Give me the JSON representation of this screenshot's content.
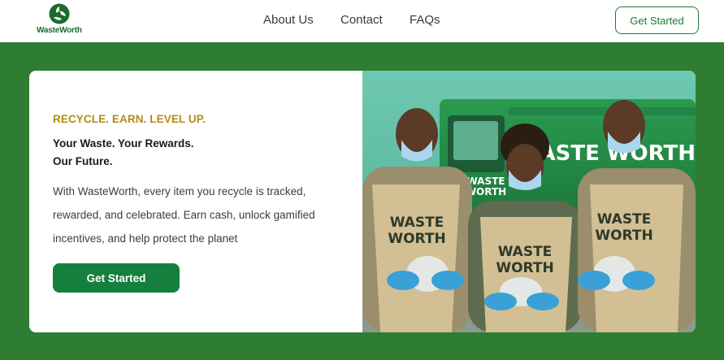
{
  "brand": {
    "name": "WasteWorth",
    "logo_icon": "recycle-leaf-icon",
    "primary_color": "#1e7a35",
    "background_color": "#2f7d32",
    "accent_color": "#b38b12"
  },
  "nav": {
    "links": [
      "About Us",
      "Contact",
      "FAQs"
    ],
    "cta_label": "Get Started"
  },
  "hero": {
    "eyebrow": "RECYCLE. EARN. LEVEL UP.",
    "headline_line1": "Your Waste. Your Rewards.",
    "headline_line2": "Our Future.",
    "body_line1": "With WasteWorth, every item you recycle is tracked,",
    "body_line2": "rewarded, and celebrated. Earn cash, unlock gamified",
    "body_line3": "incentives, and help protect the planet",
    "cta_label": "Get Started",
    "photo": {
      "truck_text": "WASTE WORTH",
      "door_text_line1": "WASTE",
      "door_text_line2": "WORTH",
      "apron_text_line1": "WASTE",
      "apron_text_line2": "WORTH"
    }
  }
}
